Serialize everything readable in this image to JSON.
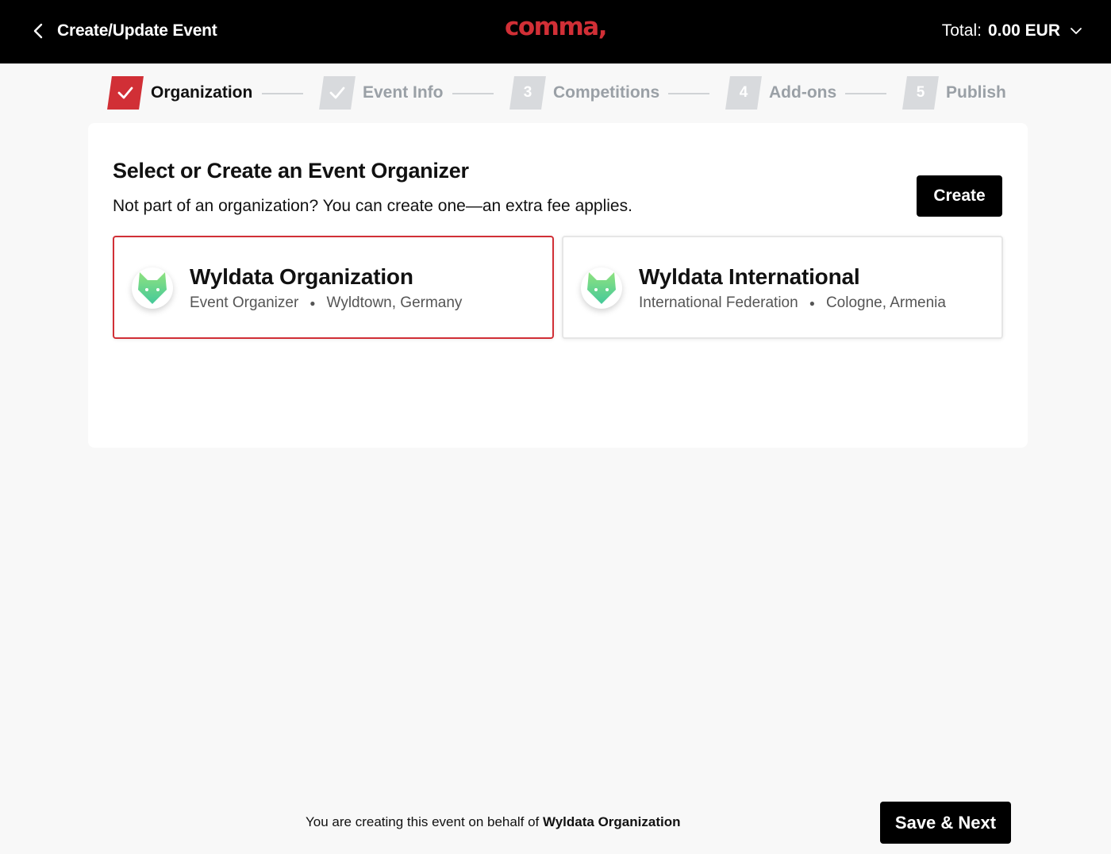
{
  "header": {
    "title": "Create/Update Event",
    "logo_text": "comma,",
    "total_label": "Total:",
    "total_amount": "0.00 EUR"
  },
  "stepper": {
    "steps": [
      {
        "label": "Organization",
        "number": "",
        "status": "done-active"
      },
      {
        "label": "Event Info",
        "number": "",
        "status": "done"
      },
      {
        "label": "Competitions",
        "number": "3",
        "status": "pending"
      },
      {
        "label": "Add-ons",
        "number": "4",
        "status": "pending"
      },
      {
        "label": "Publish",
        "number": "5",
        "status": "pending"
      }
    ]
  },
  "organizer": {
    "heading": "Select or Create an Event Organizer",
    "subtitle": "Not part of an organization? You can create one—an extra fee applies.",
    "create_label": "Create",
    "options": [
      {
        "name": "Wyldata Organization",
        "role": "Event Organizer",
        "location": "Wyldtown, Germany",
        "selected": true
      },
      {
        "name": "Wyldata International",
        "role": "International Federation",
        "location": "Cologne, Armenia",
        "selected": false
      }
    ]
  },
  "footer": {
    "note_prefix": "You are creating this event on behalf of",
    "note_org": "Wyldata Organization",
    "save_label": "Save & Next"
  },
  "colors": {
    "accent": "#d12f36",
    "header_bg": "#000000",
    "step_inactive": "#d8dadd",
    "avatar_green": "#5fd68a"
  }
}
